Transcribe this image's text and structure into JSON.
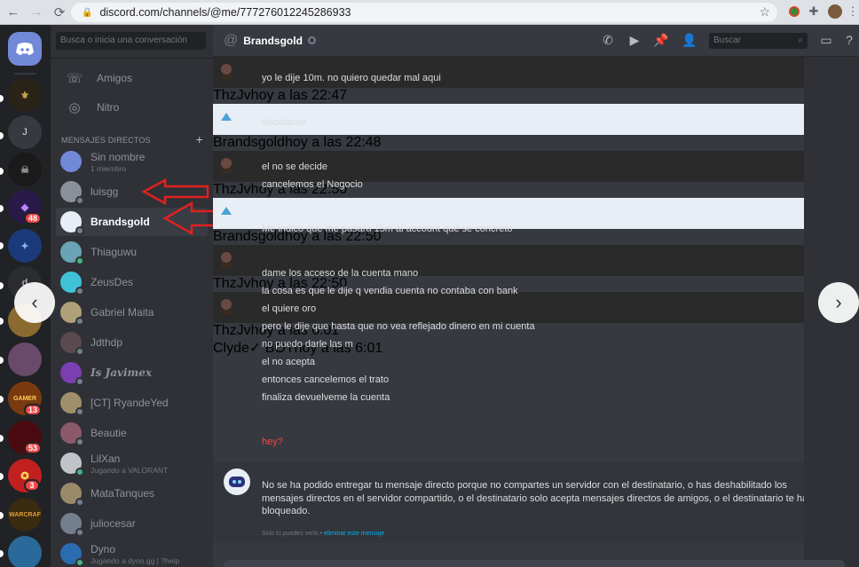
{
  "browser": {
    "url": "discord.com/channels/@me/777276012245286933",
    "back": "←",
    "forward": "→",
    "reload": "⟳"
  },
  "rail": {
    "user_initial": "J",
    "badges": [
      "48",
      "13",
      "53",
      "3"
    ]
  },
  "dm_sidebar": {
    "search_placeholder": "Busca o inicia una conversación",
    "friends_label": "Amigos",
    "nitro_label": "Nitro",
    "dm_header": "MENSAJES DIRECTOS",
    "add_symbol": "+",
    "items": [
      {
        "name": "Sin nombre",
        "sub": "1 miembro",
        "color": "#7289da"
      },
      {
        "name": "luisgg",
        "sub": "",
        "color": "#8a8f98"
      },
      {
        "name": "Brandsgold",
        "sub": "",
        "color": "#e8eef5"
      },
      {
        "name": "Thiaguwu",
        "sub": "",
        "color": "#6aa3b5"
      },
      {
        "name": "ZeusDes",
        "sub": "",
        "color": "#3fc2d6"
      },
      {
        "name": "Gabriel Maita",
        "sub": "",
        "color": "#b0a07a"
      },
      {
        "name": "Jdthdp",
        "sub": "",
        "color": "#5a4a50"
      },
      {
        "name": "Is Javimex",
        "sub": "",
        "color": "#7a3fb0"
      },
      {
        "name": "[CT] RyandeYed",
        "sub": "",
        "color": "#a08f6a"
      },
      {
        "name": "Beautie",
        "sub": "",
        "color": "#8a5a6a"
      },
      {
        "name": "LilXan",
        "sub": "Jugando a VALORANT",
        "color": "#c0c4c8"
      },
      {
        "name": "MataTanques",
        "sub": "",
        "color": "#9a8a6a"
      },
      {
        "name": "juliocesar",
        "sub": "",
        "color": "#747f8d"
      },
      {
        "name": "Dyno",
        "sub": "Jugando a dyno.gg | ?help",
        "color": "#2b6cb0"
      }
    ]
  },
  "chat": {
    "title": "Brandsgold",
    "search_placeholder": "Buscar",
    "messages": [
      {
        "author": "ThzJv",
        "time": "hoy a las 22:47",
        "lines": [
          "yo le dije 10m. no quiero quedar mal aqui"
        ]
      },
      {
        "author": "Brandsgold",
        "time": "hoy a las 22:48",
        "lines": [
          "decidanse."
        ]
      },
      {
        "author": "ThzJv",
        "time": "hoy a las 22:50",
        "lines": [
          "el no se decide",
          "cancelemos el Negocio"
        ]
      },
      {
        "author": "Brandsgold",
        "time": "hoy a las 22:50",
        "lines": [
          "Me indico que me pasara 15m al account que se concreto"
        ]
      },
      {
        "author": "ThzJv",
        "time": "hoy a las 22:50",
        "lines": [
          "dame los acceso de la cuenta mano",
          "la cosa es que le dije q vendia cuenta no contaba con bank",
          "el quiere oro",
          "pero le dije que hasta que no vea reflejado dinero en mi cuenta",
          "no puedo darle las m",
          "el no acepta",
          "entonces cancelemos el trato",
          "finaliza devuelveme la cuenta"
        ]
      },
      {
        "author": "ThzJv",
        "time": "hoy a las 6:01",
        "lines": [
          "hey?"
        ]
      }
    ],
    "clyde": {
      "author": "Clyde",
      "badge": "✓ BOT",
      "time": "hoy a las 6:01",
      "text": "No se ha podido entregar tu mensaje directo porque no compartes un servidor con el destinatario, o has deshabilitado los mensajes directos en el servidor compartido, o el destinatario solo acepta mensajes directos de amigos, o el destinatario te ha bloqueado.",
      "ephemeral_note": "Solo tú puedes verlo •",
      "ephemeral_link": "eliminar este mensaje"
    }
  },
  "carousel": {
    "prev": "‹",
    "next": "›"
  },
  "colors": {
    "annotation_arrow": "#e02020",
    "accent": "#7289da"
  }
}
